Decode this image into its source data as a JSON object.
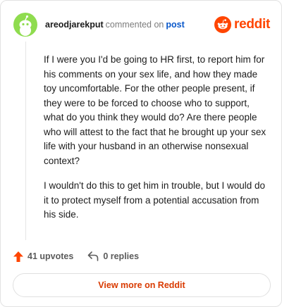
{
  "header": {
    "username": "areodjarekput",
    "action_text": "commented on",
    "post_link": "post",
    "brand": "reddit"
  },
  "comment": {
    "paragraphs": [
      "If I were you I'd be going to HR first, to report him for his comments on your sex life, and how they made toy uncomfortable. For the other people present, if they were to be forced to choose who to support, what do you think they would do? Are there people who will attest to the fact that he brought up your sex life with your husband in an otherwise nonsexual context?",
      "I wouldn't do this to get him in trouble, but I would do it to protect myself from a potential accusation from his side."
    ]
  },
  "actions": {
    "upvotes": "41 upvotes",
    "replies": "0 replies"
  },
  "footer": {
    "view_more": "View more on Reddit"
  },
  "colors": {
    "brand": "#ff4500",
    "link": "#0a58ca",
    "avatar_bg": "#8fdc4f",
    "view_more": "#d93a00"
  }
}
